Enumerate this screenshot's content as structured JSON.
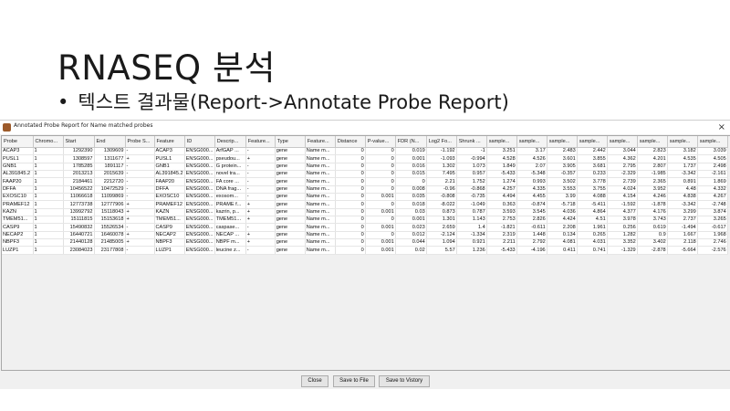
{
  "slide": {
    "title": "RNASEQ 분석",
    "bullet": "텍스트 결과물(Report->Annotate Probe Report)"
  },
  "window": {
    "title": "Annotated Probe Report for Name matched probes",
    "close_glyph": "×"
  },
  "table": {
    "columns": [
      "Probe",
      "Chromo...",
      "Start",
      "End",
      "Probe S...",
      "Feature",
      "ID",
      "Descrip...",
      "Feature...",
      "Type",
      "Feature...",
      "Distance",
      "P-value...",
      "FDR (N...",
      "Log2 Fo...",
      "Shrunk ...",
      "sample...",
      "sample...",
      "sample...",
      "sample...",
      "sample...",
      "sample...",
      "sample...",
      "sample..."
    ],
    "rows": [
      [
        "ACAP3",
        "1",
        "1292390",
        "1309609",
        "-",
        "ACAP3",
        "ENSG000...",
        "ArfGAP ...",
        "-",
        "gene",
        "Name m...",
        "0",
        "0",
        "0.019",
        "-1.192",
        "-1",
        "3.251",
        "3.17",
        "2.483",
        "2.442",
        "3.044",
        "2.823",
        "3.182",
        "3.039"
      ],
      [
        "PUSL1",
        "1",
        "1308597",
        "1311677",
        "+",
        "PUSL1",
        "ENSG000...",
        "pseudou...",
        "+",
        "gene",
        "Name m...",
        "0",
        "0",
        "0.001",
        "-1.093",
        "-0.994",
        "4.528",
        "4.526",
        "3.601",
        "3.855",
        "4.362",
        "4.201",
        "4.535",
        "4.505"
      ],
      [
        "GNB1",
        "1",
        "1785285",
        "1891117",
        "-",
        "GNB1",
        "ENSG000...",
        "G protein...",
        "-",
        "gene",
        "Name m...",
        "0",
        "0",
        "0.016",
        "1.302",
        "1.073",
        "1.849",
        "2.07",
        "3.905",
        "3.681",
        "2.795",
        "2.807",
        "1.737",
        "2.498"
      ],
      [
        "AL391845.2",
        "1",
        "2013213",
        "2015639",
        "-",
        "AL391845.2",
        "ENSG000...",
        "novel tra...",
        "-",
        "gene",
        "Name m...",
        "0",
        "0",
        "0.015",
        "7.495",
        "0.957",
        "-5.433",
        "-5.348",
        "-0.357",
        "0.233",
        "-2.329",
        "-1.985",
        "-3.342",
        "-2.161"
      ],
      [
        "FAAP20",
        "1",
        "2184461",
        "2212720",
        "-",
        "FAAP20",
        "ENSG000...",
        "FA core ...",
        "-",
        "gene",
        "Name m...",
        "0",
        "0",
        "0",
        "2.21",
        "1.752",
        "1.274",
        "0.993",
        "3.502",
        "3.778",
        "2.739",
        "2.365",
        "0.891",
        "1.869"
      ],
      [
        "DFFA",
        "1",
        "10456522",
        "10472529",
        "-",
        "DFFA",
        "ENSG000...",
        "DNA frag...",
        "-",
        "gene",
        "Name m...",
        "0",
        "0",
        "0.008",
        "-0.96",
        "-0.868",
        "4.257",
        "4.335",
        "3.553",
        "3.755",
        "4.024",
        "3.952",
        "4.48",
        "4.332"
      ],
      [
        "EXOSC10",
        "1",
        "11066618",
        "11099869",
        "-",
        "EXOSC10",
        "ENSG000...",
        "exosom...",
        "-",
        "gene",
        "Name m...",
        "0",
        "0.001",
        "0.035",
        "-0.808",
        "-0.735",
        "4.494",
        "4.455",
        "3.99",
        "4.088",
        "4.154",
        "4.246",
        "4.838",
        "4.267"
      ],
      [
        "PRAMEF12",
        "1",
        "12773738",
        "12777906",
        "+",
        "PRAMEF12",
        "ENSG000...",
        "PRAME f...",
        "+",
        "gene",
        "Name m...",
        "0",
        "0",
        "0.018",
        "-8.022",
        "-1.049",
        "0.363",
        "-0.874",
        "-5.718",
        "-5.411",
        "-1.592",
        "-1.878",
        "-3.342",
        "-2.748"
      ],
      [
        "KAZN",
        "1",
        "13992792",
        "15118043",
        "+",
        "KAZN",
        "ENSG000...",
        "kazrin, p...",
        "+",
        "gene",
        "Name m...",
        "0",
        "0.001",
        "0.03",
        "0.873",
        "0.787",
        "3.593",
        "3.545",
        "4.036",
        "4.864",
        "4.377",
        "4.176",
        "3.299",
        "3.874"
      ],
      [
        "TMEM51...",
        "1",
        "15111815",
        "15153618",
        "+",
        "TMEM51...",
        "ENSG000...",
        "TMEM51...",
        "+",
        "gene",
        "Name m...",
        "0",
        "0",
        "0.001",
        "1.301",
        "1.143",
        "2.753",
        "2.826",
        "4.424",
        "4.51",
        "3.978",
        "3.743",
        "2.737",
        "3.265"
      ],
      [
        "CASP9",
        "1",
        "15490832",
        "15526534",
        "-",
        "CASP9",
        "ENSG000...",
        "caspase...",
        "-",
        "gene",
        "Name m...",
        "0",
        "0.001",
        "0.023",
        "2.659",
        "1.4",
        "-1.821",
        "-0.611",
        "2.208",
        "1.961",
        "0.256",
        "0.619",
        "-1.494",
        "-0.617"
      ],
      [
        "NECAP2",
        "1",
        "16440721",
        "16460078",
        "+",
        "NECAP2",
        "ENSG000...",
        "NECAP ...",
        "+",
        "gene",
        "Name m...",
        "0",
        "0",
        "0.012",
        "-2.124",
        "-1.334",
        "2.319",
        "1.448",
        "0.134",
        "0.265",
        "1.282",
        "0.9",
        "1.667",
        "1.968"
      ],
      [
        "NBPF3",
        "1",
        "21440128",
        "21485005",
        "+",
        "NBPF3",
        "ENSG000...",
        "NBPF m...",
        "+",
        "gene",
        "Name m...",
        "0",
        "0.001",
        "0.044",
        "1.094",
        "0.921",
        "2.211",
        "2.792",
        "4.081",
        "4.031",
        "3.352",
        "3.402",
        "2.118",
        "2.746"
      ],
      [
        "LUZP1",
        "1",
        "23084023",
        "23177808",
        "-",
        "LUZP1",
        "ENSG000...",
        "leucine z...",
        "-",
        "gene",
        "Name m...",
        "0",
        "0.001",
        "0.02",
        "5.57",
        "1.236",
        "-5.433",
        "-4.196",
        "0.411",
        "0.741",
        "-1.329",
        "-2.878",
        "-5.664",
        "-2.576"
      ]
    ]
  },
  "buttons": {
    "close": "Close",
    "save_file": "Save to File",
    "save_vistory": "Save to Vistory"
  }
}
